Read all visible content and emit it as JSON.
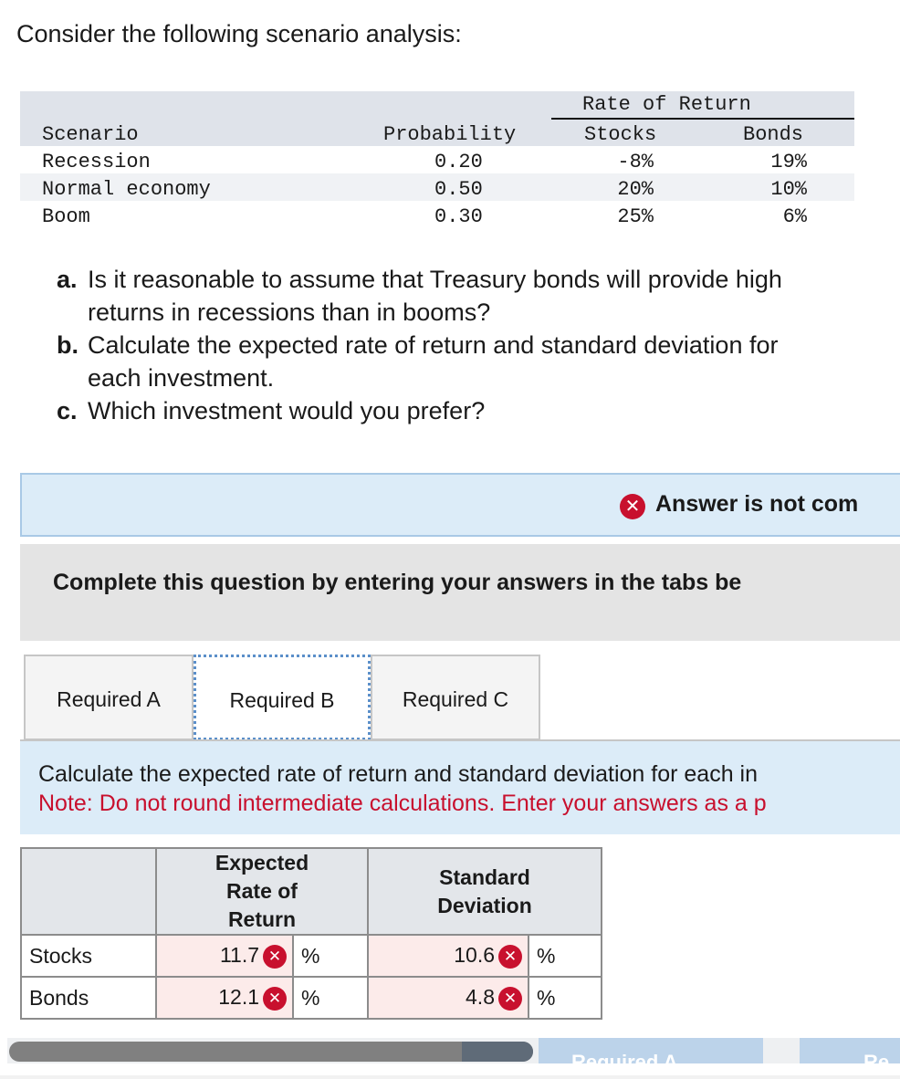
{
  "intro": "Consider the following scenario analysis:",
  "scenario_table": {
    "group_header": "Rate of Return",
    "headers": {
      "scenario": "Scenario",
      "probability": "Probability",
      "stocks": "Stocks",
      "bonds": "Bonds"
    },
    "rows": [
      {
        "scenario": "Recession",
        "probability": "0.20",
        "stocks": "-8%",
        "bonds": "19%"
      },
      {
        "scenario": "Normal economy",
        "probability": "0.50",
        "stocks": "20%",
        "bonds": "10%"
      },
      {
        "scenario": "Boom",
        "probability": "0.30",
        "stocks": "25%",
        "bonds": "6%"
      }
    ]
  },
  "questions": [
    {
      "marker": "a.",
      "line1": "Is it reasonable to assume that Treasury bonds will provide high",
      "line2": "returns in recessions than in booms?"
    },
    {
      "marker": "b.",
      "line1": "Calculate the expected rate of return and standard deviation for",
      "line2": "each investment."
    },
    {
      "marker": "c.",
      "line1": "Which investment would you prefer?",
      "line2": ""
    }
  ],
  "status": {
    "message": "Answer is not com"
  },
  "complete_banner": "Complete this question by entering your answers in the tabs be",
  "tabs": [
    {
      "label": "Required A",
      "active": false
    },
    {
      "label": "Required B",
      "active": true
    },
    {
      "label": "Required C",
      "active": false
    }
  ],
  "instructions": {
    "line1": "Calculate the expected rate of return and standard deviation for each in",
    "note": "Note: Do not round intermediate calculations. Enter your answers as a p"
  },
  "answer_table": {
    "headers": {
      "expected_l1": "Expected",
      "expected_l2": "Rate of",
      "expected_l3": "Return",
      "std_l1": "Standard",
      "std_l2": "Deviation"
    },
    "rows": [
      {
        "label": "Stocks",
        "expected": "11.7",
        "expected_unit": "%",
        "std": "10.6",
        "std_unit": "%"
      },
      {
        "label": "Bonds",
        "expected": "12.1",
        "expected_unit": "%",
        "std": "4.8",
        "std_unit": "%"
      }
    ]
  },
  "footer_nav": {
    "prev_label": "Required A",
    "next_label": "Re"
  },
  "colors": {
    "error_red": "#c8102e",
    "info_blue": "#dcecf8",
    "banner_gray": "#e4e4e4"
  }
}
